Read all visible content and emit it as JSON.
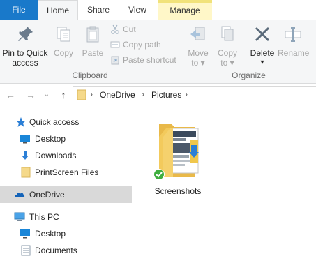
{
  "tabs": {
    "file": "File",
    "home": "Home",
    "share": "Share",
    "view": "View",
    "manage": "Manage"
  },
  "ribbon": {
    "clipboard": {
      "pin_line1": "Pin to Quick",
      "pin_line2": "access",
      "copy": "Copy",
      "paste": "Paste",
      "cut": "Cut",
      "copy_path": "Copy path",
      "paste_shortcut": "Paste shortcut",
      "group_label": "Clipboard"
    },
    "organize": {
      "move_to_line1": "Move",
      "move_to_line2": "to",
      "copy_to_line1": "Copy",
      "copy_to_line2": "to",
      "delete": "Delete",
      "rename": "Rename",
      "group_label": "Organize"
    }
  },
  "address": {
    "crumbs": [
      "OneDrive",
      "Pictures"
    ]
  },
  "nav": {
    "quick_access": "Quick access",
    "desktop": "Desktop",
    "downloads": "Downloads",
    "printscreen_files": "PrintScreen Files",
    "onedrive": "OneDrive",
    "this_pc": "This PC",
    "pc_desktop": "Desktop",
    "pc_documents": "Documents"
  },
  "content": {
    "items": [
      {
        "name": "Screenshots",
        "sync_status": "synced"
      }
    ]
  },
  "colors": {
    "file_tab": "#1979ca",
    "manage_tab": "#fff7c8",
    "selected_nav": "#d9d9d9",
    "folder": "#f0c74c",
    "sync_ok": "#3fae3f"
  }
}
